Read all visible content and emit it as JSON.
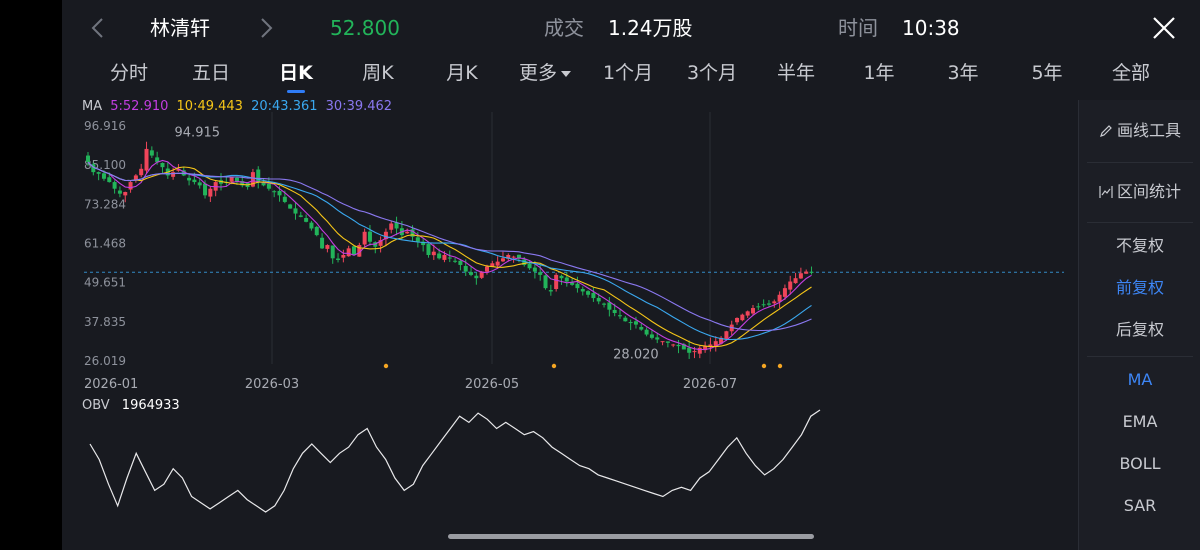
{
  "header": {
    "stock_name": "林清轩",
    "price": "52.800",
    "volume_label": "成交",
    "volume_value": "1.24万股",
    "time_label": "时间",
    "time_value": "10:38"
  },
  "tabs": [
    {
      "label": "分时",
      "active": false
    },
    {
      "label": "五日",
      "active": false
    },
    {
      "label": "日K",
      "active": true
    },
    {
      "label": "周K",
      "active": false
    },
    {
      "label": "月K",
      "active": false
    },
    {
      "label": "更多",
      "active": false
    },
    {
      "label": "1个月",
      "active": false
    },
    {
      "label": "3个月",
      "active": false
    },
    {
      "label": "半年",
      "active": false
    },
    {
      "label": "1年",
      "active": false
    },
    {
      "label": "3年",
      "active": false
    },
    {
      "label": "5年",
      "active": false
    },
    {
      "label": "全部",
      "active": false
    }
  ],
  "side_panel": {
    "draw_tools": "画线工具",
    "range_stats": "区间统计",
    "adjust_none": "不复权",
    "adjust_forward": "前复权",
    "adjust_backward": "后复权",
    "ma": "MA",
    "ema": "EMA",
    "boll": "BOLL",
    "sar": "SAR"
  },
  "ma_legend": {
    "label": "MA",
    "ma5": "5:52.910",
    "ma10": "10:49.443",
    "ma20": "20:43.361",
    "ma30": "30:39.462"
  },
  "colors": {
    "up": "#f0455a",
    "down": "#22b45a",
    "ma5": "#c33ee0",
    "ma10": "#f5c518",
    "ma20": "#3aa8ef",
    "ma30": "#8a78f0",
    "accent": "#3d86f6",
    "obv": "#e8e8ea"
  },
  "chart_data": [
    {
      "type": "candlestick",
      "y_ticks": [
        "96.916",
        "85.100",
        "73.284",
        "61.468",
        "49.651",
        "37.835",
        "26.019"
      ],
      "ylim": [
        26.019,
        96.916
      ],
      "x_ticks": [
        "2026-01",
        "2026-03",
        "2026-05",
        "2026-07"
      ],
      "annotations": {
        "high": "94.915",
        "low": "28.020"
      },
      "current_price_line": 52.8,
      "series": [
        {
          "name": "MA5",
          "value": 52.91
        },
        {
          "name": "MA10",
          "value": 49.443
        },
        {
          "name": "MA20",
          "value": 43.361
        },
        {
          "name": "MA30",
          "value": 39.462
        }
      ],
      "close": [
        86.0,
        83.0,
        82.5,
        81.0,
        80.0,
        78.0,
        76.5,
        77.0,
        80.0,
        82.0,
        84.0,
        90.0,
        88.0,
        86.0,
        84.5,
        82.0,
        83.0,
        84.0,
        82.0,
        80.5,
        80.0,
        79.0,
        76.0,
        78.0,
        80.0,
        79.5,
        80.0,
        81.5,
        80.0,
        79.0,
        78.5,
        83.0,
        80.0,
        79.0,
        78.0,
        77.0,
        76.0,
        74.0,
        72.0,
        70.5,
        69.5,
        68.0,
        66.0,
        64.0,
        60.0,
        61.0,
        57.0,
        56.5,
        58.0,
        60.0,
        58.0,
        61.0,
        65.0,
        62.0,
        60.5,
        62.5,
        65.0,
        67.5,
        66.0,
        64.0,
        65.0,
        63.5,
        62.0,
        61.0,
        58.0,
        59.0,
        57.0,
        58.0,
        57.0,
        56.0,
        55.0,
        53.0,
        52.0,
        51.0,
        53.0,
        54.5,
        55.5,
        56.0,
        57.0,
        58.0,
        57.5,
        57.0,
        55.0,
        54.0,
        53.0,
        52.0,
        48.0,
        47.0,
        52.0,
        51.0,
        50.0,
        49.0,
        48.0,
        47.0,
        46.0,
        45.0,
        44.0,
        43.0,
        41.5,
        40.5,
        39.5,
        38.0,
        37.5,
        37.0,
        35.5,
        34.0,
        33.0,
        32.5,
        32.0,
        31.5,
        31.0,
        30.5,
        29.5,
        28.5,
        29.0,
        30.0,
        30.5,
        31.0,
        32.0,
        33.0,
        35.0,
        37.0,
        39.0,
        40.0,
        41.0,
        42.0,
        42.5,
        43.0,
        43.0,
        44.0,
        46.0,
        48.0,
        50.0,
        51.0,
        52.5,
        53.0,
        52.8
      ]
    },
    {
      "type": "line",
      "name": "OBV",
      "label": "OBV",
      "current": "1964933",
      "values": [
        25,
        20,
        12,
        5,
        14,
        22,
        16,
        10,
        12,
        17,
        14,
        8,
        6,
        4,
        6,
        8,
        10,
        7,
        5,
        3,
        5,
        10,
        17,
        22,
        25,
        22,
        19,
        22,
        24,
        28,
        30,
        24,
        20,
        14,
        10,
        12,
        18,
        22,
        26,
        30,
        34,
        32,
        35,
        33,
        30,
        32,
        30,
        28,
        29,
        27,
        24,
        22,
        20,
        18,
        17,
        15,
        14,
        13,
        12,
        11,
        10,
        9,
        8,
        10,
        11,
        10,
        14,
        16,
        20,
        24,
        27,
        22,
        18,
        15,
        17,
        20,
        24,
        28,
        34,
        36
      ]
    }
  ]
}
